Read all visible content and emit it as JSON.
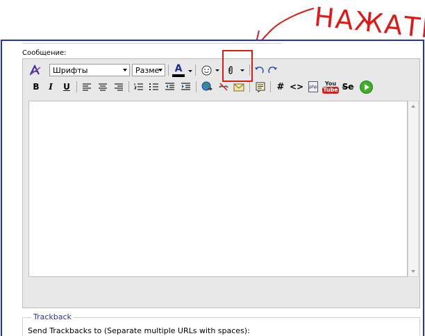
{
  "annotation": {
    "text": "НАЖАТЬ"
  },
  "form": {
    "message_label": "Сообщение:"
  },
  "toolbar": {
    "font_select": "Шрифты",
    "size_select": "Разме",
    "text_color_glyph": "A",
    "bold": "B",
    "italic": "I",
    "underline": "U",
    "hash": "#",
    "code": "<>",
    "php": "php",
    "youtube_top": "You",
    "youtube_bottom": "Tube",
    "strike": "Se"
  },
  "trackback": {
    "legend": "Trackback",
    "label": "Send Trackbacks to (Separate multiple URLs with spaces):"
  },
  "colors": {
    "frame_border": "#1f2fc8",
    "annotation": "#e01818",
    "editor_bg": "#e8e8e8",
    "youtube_red": "#d62020",
    "play_green": "#3fae2a"
  }
}
